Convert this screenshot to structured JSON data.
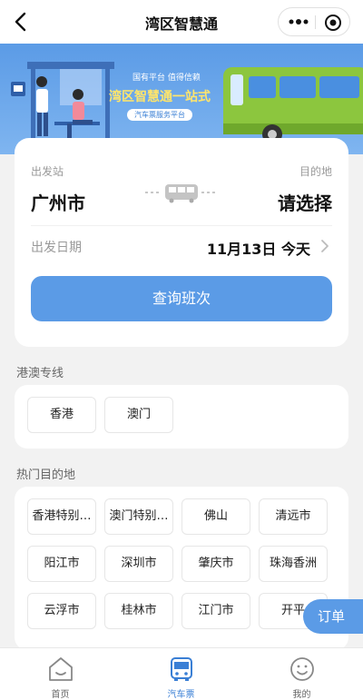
{
  "header": {
    "title": "湾区智慧通"
  },
  "banner": {
    "subtitle": "国有平台 值得信赖",
    "title": "湾区智慧通一站式",
    "pill": "汽车票服务平台"
  },
  "search": {
    "from_label": "出发站",
    "to_label": "目的地",
    "from_city": "广州市",
    "to_city": "请选择",
    "date_label": "出发日期",
    "date_value": "11月13日 今天",
    "query_button": "查询班次"
  },
  "hk_macau": {
    "title": "港澳专线",
    "items": [
      "香港",
      "澳门"
    ]
  },
  "hot": {
    "title": "热门目的地",
    "items": [
      "香港特别…",
      "澳门特别…",
      "佛山",
      "清远市",
      "阳江市",
      "深圳市",
      "肇庆市",
      "珠海香洲",
      "云浮市",
      "桂林市",
      "江门市",
      "开平"
    ]
  },
  "float": {
    "order_button": "订单"
  },
  "tabbar": {
    "items": [
      {
        "label": "首页",
        "icon": "home-icon",
        "active": false
      },
      {
        "label": "汽车票",
        "icon": "bus-icon",
        "active": true
      },
      {
        "label": "我的",
        "icon": "smile-icon",
        "active": false
      }
    ]
  },
  "colors": {
    "accent": "#5b9be6",
    "accent_dark": "#3a7fd5",
    "banner_yellow": "#ffe56b",
    "background": "#f2f2f2"
  }
}
